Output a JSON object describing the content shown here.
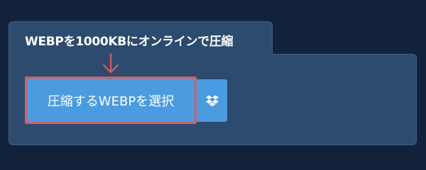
{
  "tab": {
    "title": "WEBPを1000KBにオンラインで圧縮"
  },
  "upload": {
    "select_label": "圧縮するWEBPを選択",
    "dropbox_icon": "dropbox-icon",
    "arrow_icon": "arrow-down-icon"
  },
  "colors": {
    "page_background": "#11223a",
    "card_background": "#2d4b6e",
    "button_background": "#4a9be0",
    "highlight": "#d45e62"
  }
}
